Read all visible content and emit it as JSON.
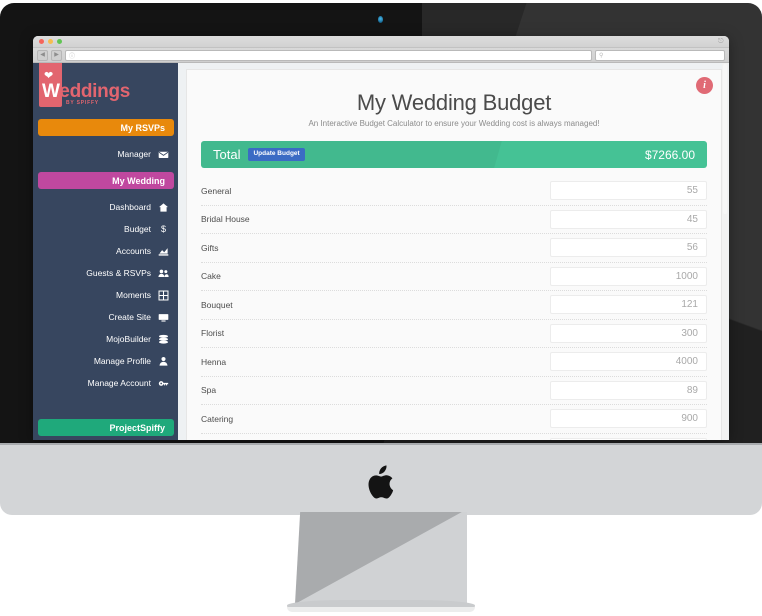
{
  "browser": {
    "url_value": "",
    "url_placeholder": "",
    "search_placeholder": "",
    "back_icon": "triangle-left-icon",
    "forward_icon": "triangle-right-icon",
    "traffic_lights": [
      "close-red",
      "minimize-yellow",
      "zoom-green"
    ]
  },
  "sidebar": {
    "logo": {
      "mark": "W",
      "rest": "eddings",
      "subtitle": "BY SPIFFY",
      "heart_icon": "heart-icon"
    },
    "section_rsvps": {
      "label": "My RSVPs",
      "color": "#e8890c"
    },
    "rsvp_items": [
      {
        "label": "Manager",
        "icon": "envelope-icon"
      }
    ],
    "section_wedding": {
      "label": "My Wedding",
      "color": "#c0489f"
    },
    "wedding_items": [
      {
        "label": "Dashboard",
        "icon": "home-icon"
      },
      {
        "label": "Budget",
        "icon": "dollar-icon"
      },
      {
        "label": "Accounts",
        "icon": "chart-icon"
      },
      {
        "label": "Guests & RSVPs",
        "icon": "users-icon"
      },
      {
        "label": "Moments",
        "icon": "photo-grid-icon"
      },
      {
        "label": "Create Site",
        "icon": "monitor-icon"
      },
      {
        "label": "MojoBuilder",
        "icon": "layers-icon"
      },
      {
        "label": "Manage Profile",
        "icon": "person-icon"
      },
      {
        "label": "Manage Account",
        "icon": "key-icon"
      }
    ],
    "footer_button": {
      "label": "ProjectSpiffy",
      "color": "#1fa97b"
    }
  },
  "main": {
    "info_badge": "i",
    "title": "My Wedding Budget",
    "subtitle": "An Interactive Budget Calculator to ensure your Wedding cost is always managed!",
    "total": {
      "label": "Total",
      "update_label": "Update Budget",
      "amount": "$7266.00",
      "color": "#45c295",
      "update_color": "#3b6bc4"
    },
    "budget_items": [
      {
        "name": "General",
        "value": "55"
      },
      {
        "name": "Bridal House",
        "value": "45"
      },
      {
        "name": "Gifts",
        "value": "56"
      },
      {
        "name": "Cake",
        "value": "1000"
      },
      {
        "name": "Bouquet",
        "value": "121"
      },
      {
        "name": "Florist",
        "value": "300"
      },
      {
        "name": "Henna",
        "value": "4000"
      },
      {
        "name": "Spa",
        "value": "89"
      },
      {
        "name": "Catering",
        "value": "900"
      },
      {
        "name": "",
        "value": ""
      }
    ]
  },
  "device": {
    "brand_logo": "apple-logo-icon",
    "camera": "webcam-icon"
  }
}
